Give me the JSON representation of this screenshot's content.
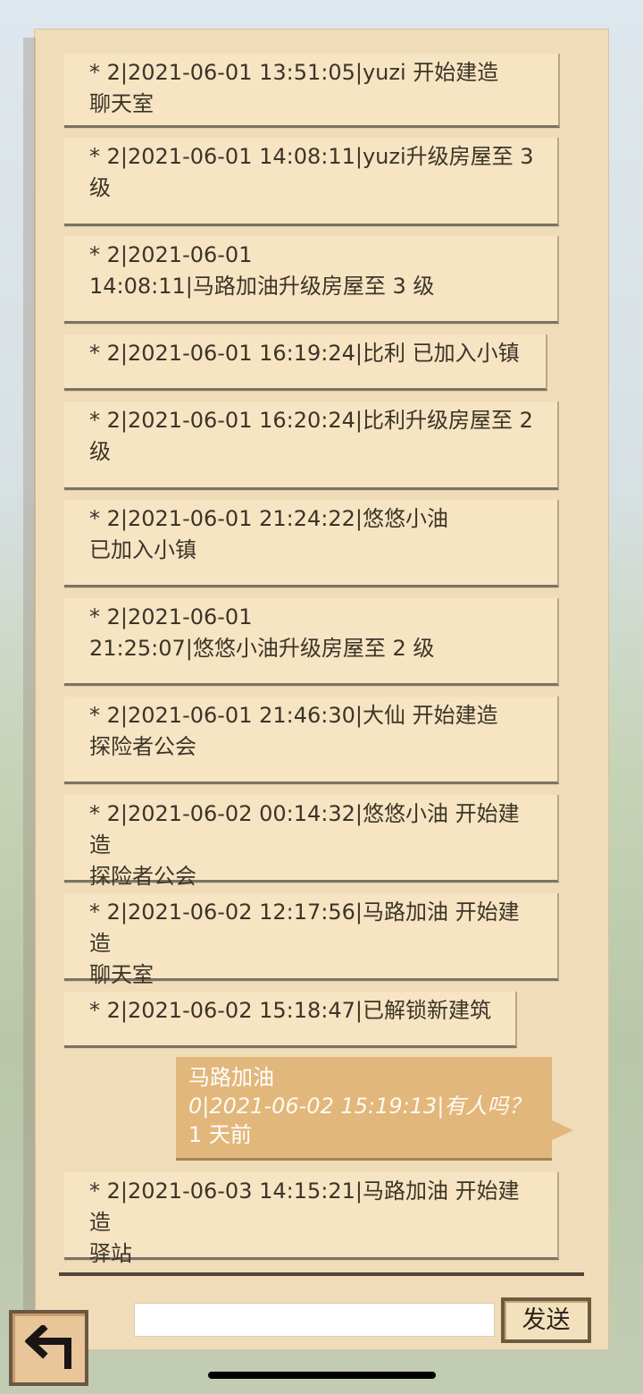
{
  "messages": [
    {
      "text": "* 2|2021-06-01 13:51:05|yuzi 开始建造\n聊天室"
    },
    {
      "text": "* 2|2021-06-01 14:08:11|yuzi升级房屋至 3\n级"
    },
    {
      "text": "* 2|2021-06-01\n14:08:11|马路加油升级房屋至 3 级"
    },
    {
      "text": "* 2|2021-06-01 16:19:24|比利 已加入小镇"
    },
    {
      "text": "* 2|2021-06-01 16:20:24|比利升级房屋至 2\n级"
    },
    {
      "text": "* 2|2021-06-01 21:24:22|悠悠小油\n已加入小镇"
    },
    {
      "text": "* 2|2021-06-01\n21:25:07|悠悠小油升级房屋至 2 级"
    },
    {
      "text": "* 2|2021-06-01 21:46:30|大仙 开始建造\n探险者公会"
    },
    {
      "text": "* 2|2021-06-02 00:14:32|悠悠小油 开始建造\n探险者公会"
    },
    {
      "text": "* 2|2021-06-02 12:17:56|马路加油 开始建造\n聊天室"
    },
    {
      "text": "* 2|2021-06-02 15:18:47|已解锁新建筑"
    },
    {
      "text": "* 2|2021-06-03 14:15:21|马路加油 开始建造\n驿站"
    }
  ],
  "user_message": {
    "sender": "马路加油",
    "content": "0|2021-06-02 15:19:13|有人吗？",
    "time": "1 天前"
  },
  "input": {
    "value": ""
  },
  "buttons": {
    "send": "发送"
  },
  "colors": {
    "panel": "#f0dcb8",
    "message_bubble": "#f6e4c3",
    "user_bubble": "#e2b77b",
    "border": "#6d5a3f"
  }
}
